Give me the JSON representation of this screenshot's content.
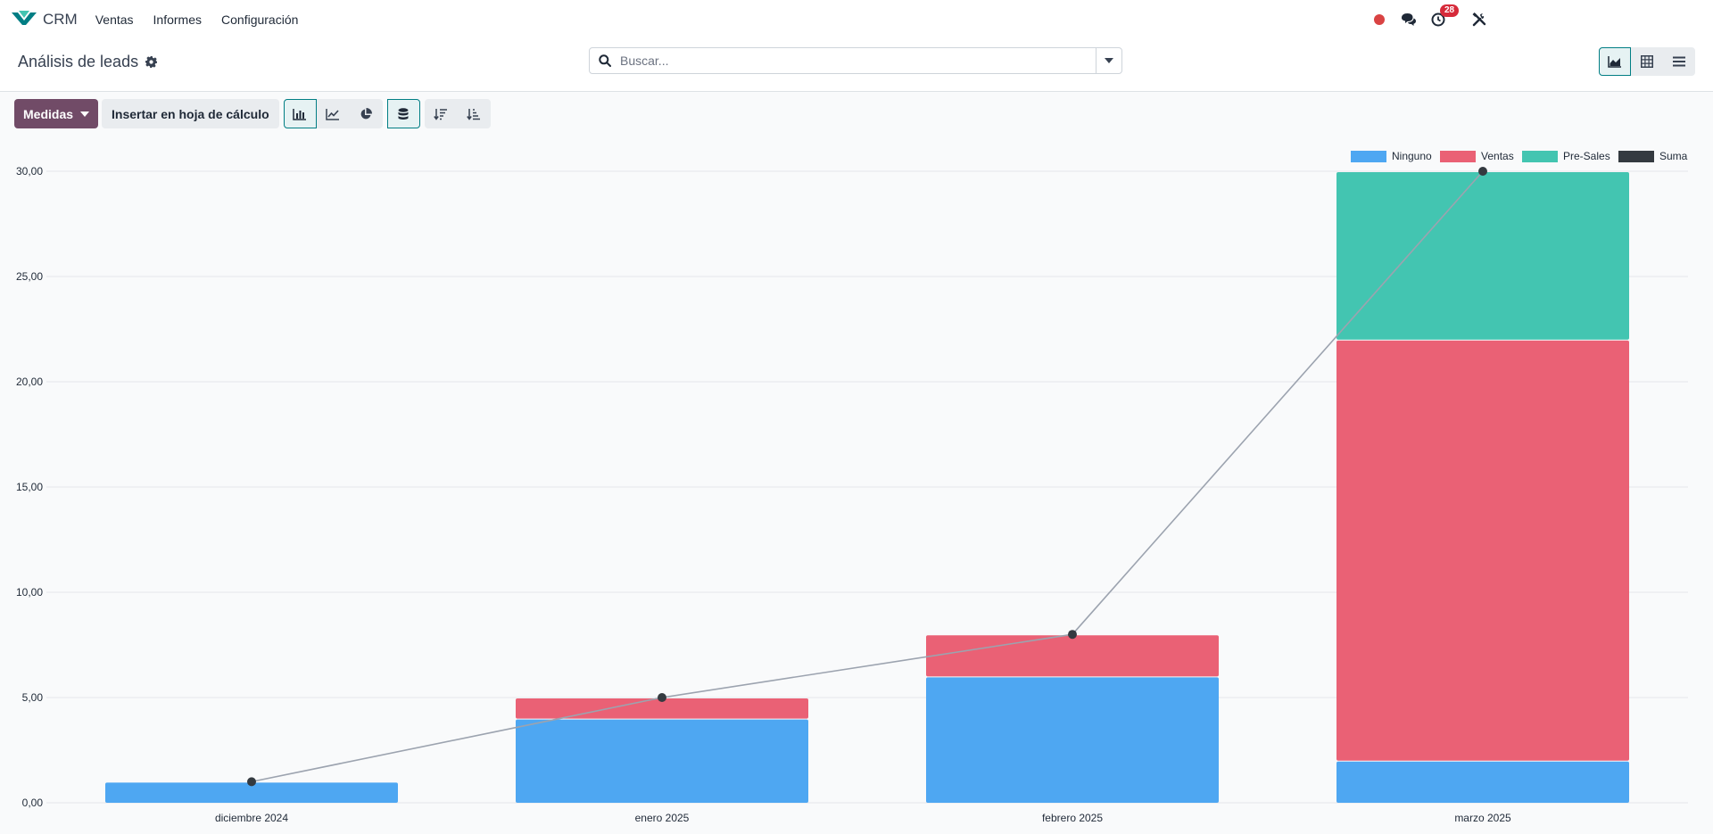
{
  "navbar": {
    "app_name": "CRM",
    "menu": [
      "Ventas",
      "Informes",
      "Configuración"
    ],
    "notification_count": "28"
  },
  "control": {
    "title": "Análisis de leads",
    "search_placeholder": "Buscar..."
  },
  "toolbar": {
    "measures_label": "Medidas",
    "insert_label": "Insertar en hoja de cálculo"
  },
  "colors": {
    "brand": "#714b67",
    "ninguno": "#4ea7f2",
    "ventas": "#ea6175",
    "presales": "#43c5b1",
    "suma": "#343a40"
  },
  "chart_data": {
    "type": "bar",
    "stacked": true,
    "categories": [
      "diciembre 2024",
      "enero 2025",
      "febrero 2025",
      "marzo 2025"
    ],
    "series": [
      {
        "name": "Ninguno",
        "values": [
          1,
          4,
          6,
          2
        ]
      },
      {
        "name": "Ventas",
        "values": [
          0,
          1,
          2,
          20
        ]
      },
      {
        "name": "Pre-Sales",
        "values": [
          0,
          0,
          0,
          8
        ]
      }
    ],
    "line_series": {
      "name": "Suma",
      "values": [
        1,
        5,
        8,
        30
      ]
    },
    "yticks": [
      "0,00",
      "5,00",
      "10,00",
      "15,00",
      "20,00",
      "25,00",
      "30,00"
    ],
    "ylim": [
      0,
      30
    ],
    "grid": true,
    "legend_position": "top-right"
  }
}
